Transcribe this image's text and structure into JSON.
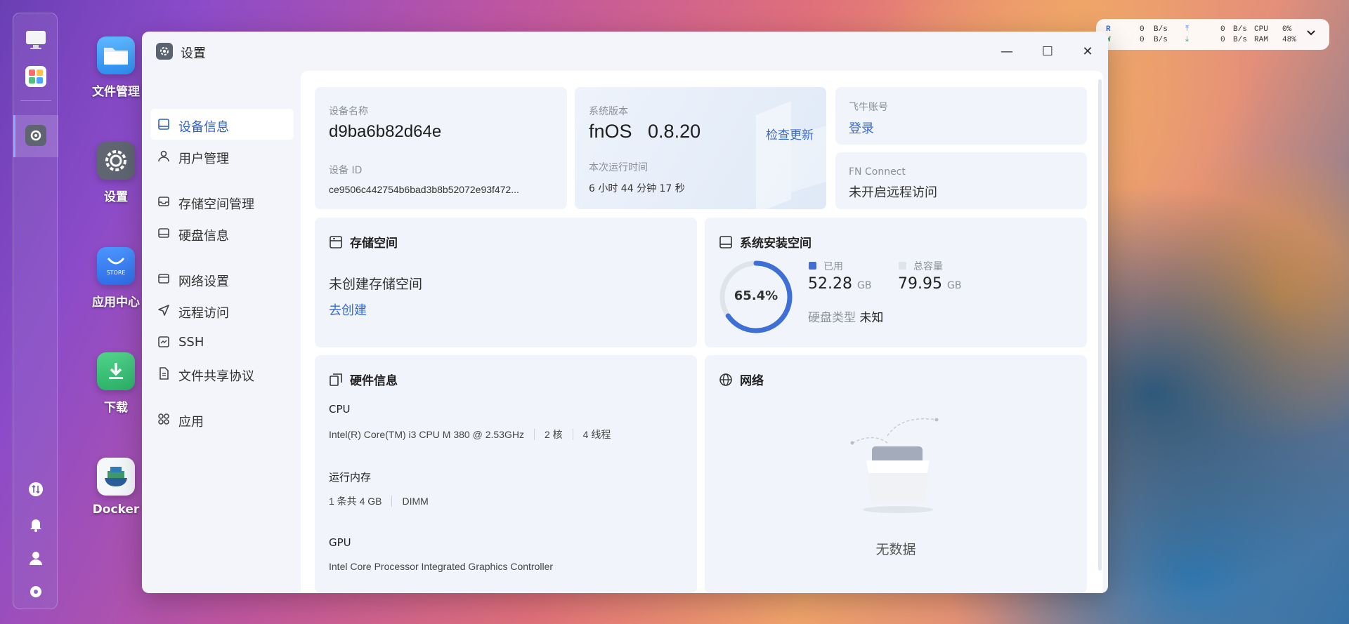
{
  "desktop": {
    "icons": [
      {
        "label": "文件管理"
      },
      {
        "label": "设置"
      },
      {
        "label": "应用中心",
        "tile_text": "STORE"
      },
      {
        "label": "下载"
      },
      {
        "label": "Docker"
      }
    ]
  },
  "monitor": {
    "r_label": "R",
    "w_label": "W",
    "r_rate": "0",
    "w_rate": "0",
    "unit": "B/s",
    "up_rate": "0",
    "down_rate": "0",
    "cpu_label": "CPU",
    "cpu_value": "0%",
    "ram_label": "RAM",
    "ram_value": "48%"
  },
  "window": {
    "title": "设置",
    "controls": {
      "minimize": "—",
      "maximize": "☐",
      "close": "✕"
    }
  },
  "sidebar": {
    "items": [
      {
        "label": "设备信息",
        "icon": "device-icon",
        "active": true
      },
      {
        "label": "用户管理",
        "icon": "user-icon"
      },
      {
        "label": "存储空间管理",
        "icon": "storage-icon"
      },
      {
        "label": "硬盘信息",
        "icon": "disk-icon"
      },
      {
        "label": "网络设置",
        "icon": "network-icon"
      },
      {
        "label": "远程访问",
        "icon": "remote-icon"
      },
      {
        "label": "SSH",
        "icon": "ssh-icon"
      },
      {
        "label": "文件共享协议",
        "icon": "file-share-icon"
      },
      {
        "label": "应用",
        "icon": "apps-icon"
      }
    ]
  },
  "device": {
    "name_label": "设备名称",
    "name": "d9ba6b82d64e",
    "id_label": "设备 ID",
    "id": "ce9506c442754b6bad3b8b52072e93f472..."
  },
  "system": {
    "version_label": "系统版本",
    "version": "fnOS   0.8.20",
    "check_update": "检查更新",
    "uptime_label": "本次运行时间",
    "uptime": "6 小时 44 分钟 17 秒"
  },
  "account": {
    "label": "飞牛账号",
    "login": "登录",
    "fn_connect_label": "FN Connect",
    "fn_connect_status": "未开启远程访问"
  },
  "storage": {
    "title": "存储空间",
    "empty": "未创建存储空间",
    "create": "去创建"
  },
  "system_space": {
    "title": "系统安装空间",
    "percent": "65.4%",
    "percent_value": 0.654,
    "used_label": "已用",
    "used_value": "52.28",
    "used_unit": "GB",
    "total_label": "总容量",
    "total_value": "79.95",
    "total_unit": "GB",
    "disk_type_label": "硬盘类型",
    "disk_type": "未知",
    "used_color": "#3d6fd6",
    "track_color": "#dfe3ea"
  },
  "hardware": {
    "title": "硬件信息",
    "cpu_label": "CPU",
    "cpu_model": "Intel(R) Core(TM) i3 CPU M 380 @ 2.53GHz",
    "cpu_cores": "2 核",
    "cpu_threads": "4 线程",
    "mem_label": "运行内存",
    "mem_summary": "1 条共 4 GB",
    "mem_type": "DIMM",
    "gpu_label": "GPU",
    "gpu_model": "Intel Core Processor Integrated Graphics Controller"
  },
  "network": {
    "title": "网络",
    "empty": "无数据"
  }
}
